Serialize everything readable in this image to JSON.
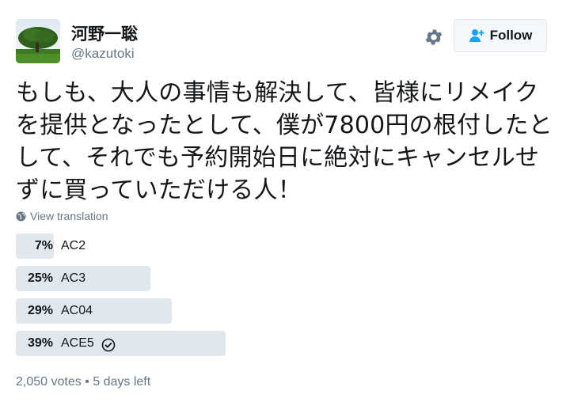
{
  "author": {
    "display_name": "河野一聡",
    "handle": "@kazutoki"
  },
  "actions": {
    "settings_icon": "gear-icon",
    "follow_label": "Follow",
    "follow_icon": "add-user-icon"
  },
  "tweet": {
    "text": "もしも、大人の事情も解決して、皆様にリメイクを提供となったとして、僕が7800円の根付したとして、それでも予約開始日に絶対にキャンセルせずに買っていただける人！",
    "translate_label": "View translation"
  },
  "poll": {
    "options": [
      {
        "percent": "7%",
        "value": 7,
        "label": "AC2",
        "winner": false
      },
      {
        "percent": "25%",
        "value": 25,
        "label": "AC3",
        "winner": false
      },
      {
        "percent": "29%",
        "value": 29,
        "label": "AC04",
        "winner": false
      },
      {
        "percent": "39%",
        "value": 39,
        "label": "ACE5",
        "winner": true
      }
    ],
    "votes": "2,050 votes",
    "separator": "•",
    "time_left": "5 days left"
  },
  "colors": {
    "bar": "#e1e8ed",
    "text": "#14171a",
    "muted": "#657786",
    "follow_icon": "#1da1f2"
  }
}
